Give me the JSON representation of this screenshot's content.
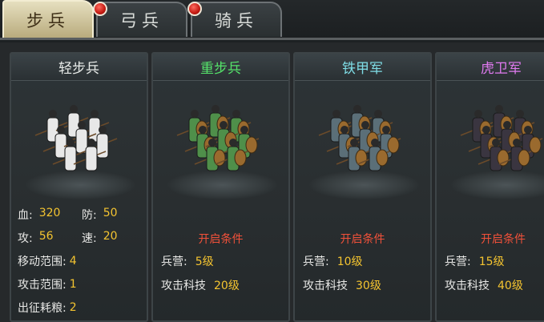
{
  "tabs": [
    {
      "label": "步兵",
      "active": true,
      "badge": false
    },
    {
      "label": "弓兵",
      "active": false,
      "badge": true
    },
    {
      "label": "骑兵",
      "active": false,
      "badge": true
    }
  ],
  "colors": {
    "title_green": "#55e36a",
    "title_cyan": "#7fdde6",
    "title_purple": "#e07af0",
    "value_yellow": "#f4c430",
    "condition_red": "#f2513a"
  },
  "units": [
    {
      "name": "轻步兵",
      "name_color": "#e9ecea",
      "figure_color": "#e8e8e8",
      "stats": {
        "hp_label": "血:",
        "hp": "320",
        "def_label": "防:",
        "def": "50",
        "atk_label": "攻:",
        "atk": "56",
        "spd_label": "速:",
        "spd": "20",
        "move_label": "移动范围:",
        "move": "4",
        "range_label": "攻击范围:",
        "range": "1",
        "food_label": "出征耗粮:",
        "food": "2"
      }
    },
    {
      "name": "重步兵",
      "name_color": "#55e36a",
      "figure_color": "#4f8f4a",
      "condition_title": "开启条件",
      "barracks_label": "兵营:",
      "barracks": "5级",
      "tech_label": "攻击科技",
      "tech": "20级"
    },
    {
      "name": "铁甲军",
      "name_color": "#7fdde6",
      "figure_color": "#5b6f78",
      "condition_title": "开启条件",
      "barracks_label": "兵营:",
      "barracks": "10级",
      "tech_label": "攻击科技",
      "tech": "30级"
    },
    {
      "name": "虎卫军",
      "name_color": "#e07af0",
      "figure_color": "#3a3540",
      "condition_title": "开启条件",
      "barracks_label": "兵营:",
      "barracks": "15级",
      "tech_label": "攻击科技",
      "tech": "40级"
    }
  ]
}
